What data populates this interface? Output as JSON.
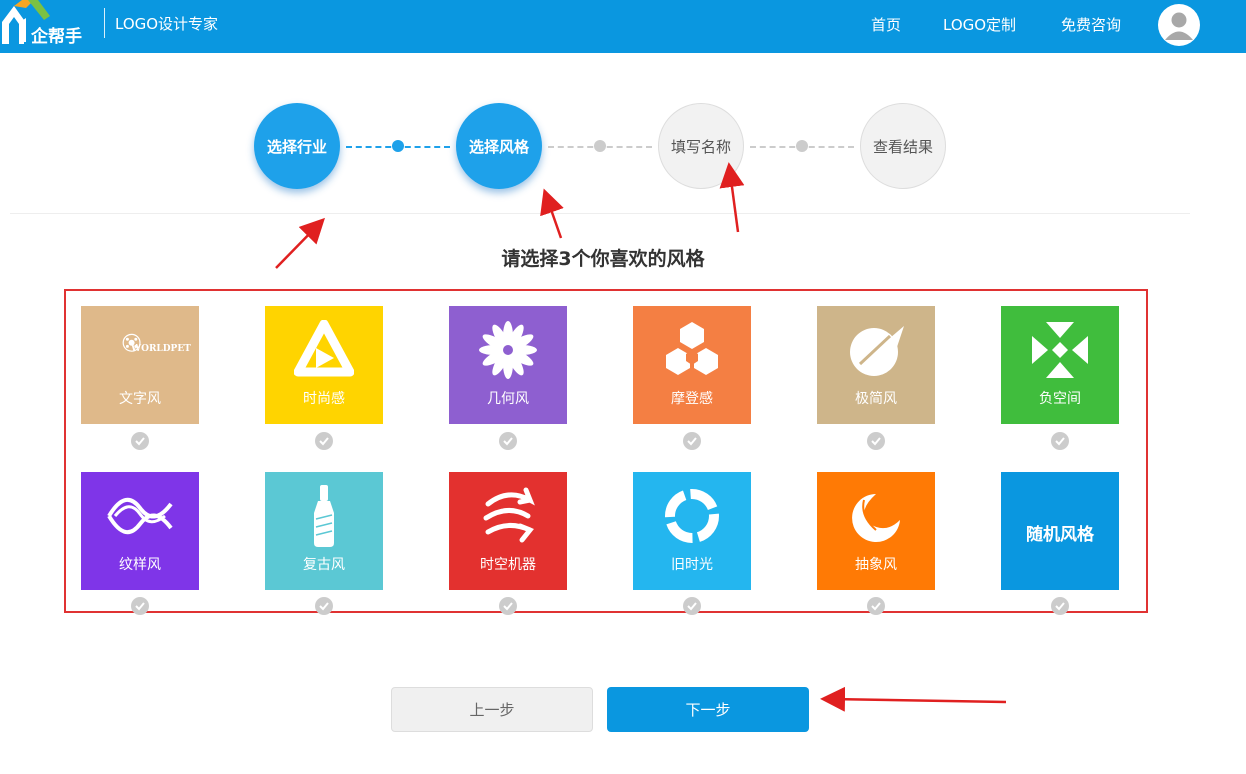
{
  "header": {
    "brand": "企帮手",
    "app_title": "LOGO设计专家",
    "nav": [
      "首页",
      "LOGO定制",
      "免费咨询"
    ]
  },
  "steps": [
    {
      "label": "选择行业",
      "state": "active"
    },
    {
      "label": "选择风格",
      "state": "active"
    },
    {
      "label": "填写名称",
      "state": "inactive"
    },
    {
      "label": "查看结果",
      "state": "inactive"
    }
  ],
  "heading": "请选择3个你喜欢的风格",
  "styles": [
    {
      "label": "文字风",
      "bg": "#dfb98a",
      "icon": "worldpet-badge-icon",
      "mark_text": "WORLDPET"
    },
    {
      "label": "时尚感",
      "bg": "#ffd400",
      "icon": "triangle-play-icon"
    },
    {
      "label": "几何风",
      "bg": "#8e5fd0",
      "icon": "flower-icon"
    },
    {
      "label": "摩登感",
      "bg": "#f47f43",
      "icon": "hexagon-cubes-icon"
    },
    {
      "label": "极简风",
      "bg": "#ceb58a",
      "icon": "circle-leaf-icon"
    },
    {
      "label": "负空间",
      "bg": "#40bd3d",
      "icon": "crossed-arrows-icon"
    },
    {
      "label": "纹样风",
      "bg": "#7f35e8",
      "icon": "wave-knot-icon"
    },
    {
      "label": "复古风",
      "bg": "#5bc8d4",
      "icon": "bottle-icon"
    },
    {
      "label": "时空机器",
      "bg": "#e3312f",
      "icon": "spiral-arrows-icon"
    },
    {
      "label": "旧时光",
      "bg": "#24b6ef",
      "icon": "ring-arrows-icon"
    },
    {
      "label": "抽象风",
      "bg": "#ff7a05",
      "icon": "sphere-sweep-icon"
    },
    {
      "label": "随机风格",
      "bg": "#0a97e0",
      "icon": "",
      "center_text": true
    }
  ],
  "buttons": {
    "prev": "上一步",
    "next": "下一步"
  },
  "colors": {
    "primary": "#0a97e0",
    "accent_red": "#e03232",
    "step_active": "#1ea1ea"
  }
}
